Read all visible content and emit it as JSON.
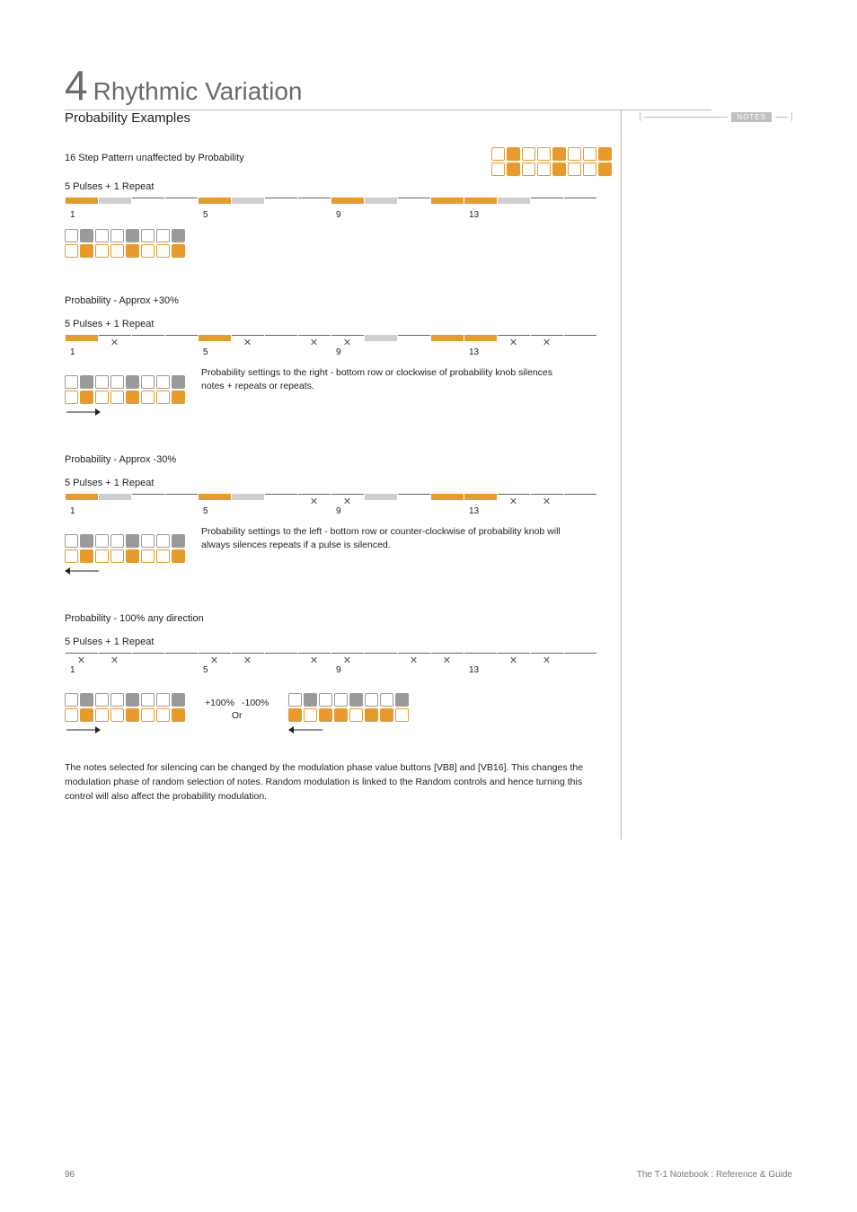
{
  "chapter": {
    "number": "4",
    "title": "Rhythmic Variation"
  },
  "notes_label": "NOTES",
  "subtitle": "Probability Examples",
  "ex1": {
    "caption_top": "16 Step Pattern unaffected by Probability",
    "caption_sub": "5 Pulses + 1 Repeat",
    "grid_top": [
      "",
      "f",
      "",
      "",
      "f",
      "",
      "",
      "f"
    ],
    "grid_bot": [
      "",
      "f",
      "",
      "",
      "f",
      "",
      "",
      "f"
    ],
    "nums": {
      "n1": "1",
      "n5": "5",
      "n9": "9",
      "n13": "13"
    }
  },
  "ex2": {
    "caption_top": "Probability - Approx +30%",
    "caption_sub": "5 Pulses + 1 Repeat",
    "grid_top": [
      "",
      "f",
      "",
      "",
      "f",
      "",
      "",
      "f"
    ],
    "grid_bot": [
      "",
      "f",
      "",
      "",
      "f",
      "",
      "",
      "f"
    ],
    "side": "Probability settings to the right - bottom row or clockwise of probability knob silences notes + repeats or repeats.",
    "nums": {
      "n1": "1",
      "n5": "5",
      "n9": "9",
      "n13": "13"
    }
  },
  "ex3": {
    "caption_top": "Probability - Approx -30%",
    "caption_sub": "5 Pulses + 1 Repeat",
    "grid_top": [
      "",
      "f",
      "",
      "",
      "f",
      "",
      "",
      "f"
    ],
    "grid_bot": [
      "",
      "f",
      "",
      "",
      "f",
      "",
      "",
      "f"
    ],
    "side": "Probability settings to the left - bottom row or counter-clockwise of probability knob will always silences repeats if a pulse is silenced.",
    "nums": {
      "n1": "1",
      "n5": "5",
      "n9": "9",
      "n13": "13"
    }
  },
  "ex4": {
    "caption_top": "Probability - 100% any direction",
    "caption_sub": "5 Pulses + 1 Repeat",
    "left_label": "+100%",
    "right_label": "-100%",
    "mid_label": "Or",
    "nums": {
      "n1": "1",
      "n5": "5",
      "n9": "9",
      "n13": "13"
    }
  },
  "body_text": "The notes selected for silencing can be changed by the modulation phase value buttons [VB8] and [VB16]. This changes the modulation phase of random selection of notes. Random modulation is linked to the Random controls and hence turning this control will also affect the probability modulation.",
  "footer": {
    "page": "96",
    "book": "The T-1 Notebook : Reference & Guide"
  },
  "chart_data": [
    {
      "type": "table",
      "title": "16 Step Pattern unaffected by Probability — 5 Pulses + 1 Repeat",
      "columns": [
        "step",
        "state"
      ],
      "rows": [
        [
          1,
          "pulse"
        ],
        [
          2,
          "repeat"
        ],
        [
          3,
          "off"
        ],
        [
          4,
          "off"
        ],
        [
          5,
          "pulse"
        ],
        [
          6,
          "repeat"
        ],
        [
          7,
          "off"
        ],
        [
          8,
          "off"
        ],
        [
          9,
          "pulse"
        ],
        [
          10,
          "repeat"
        ],
        [
          11,
          "off"
        ],
        [
          12,
          "pulse"
        ],
        [
          13,
          "pulse"
        ],
        [
          14,
          "repeat"
        ],
        [
          15,
          "off"
        ],
        [
          16,
          "off"
        ]
      ]
    },
    {
      "type": "table",
      "title": "Probability Approx +30% — silenced steps",
      "columns": [
        "step",
        "state"
      ],
      "rows": [
        [
          1,
          "pulse"
        ],
        [
          2,
          "silenced"
        ],
        [
          3,
          "off"
        ],
        [
          4,
          "off"
        ],
        [
          5,
          "pulse"
        ],
        [
          6,
          "silenced"
        ],
        [
          7,
          "off"
        ],
        [
          8,
          "silenced"
        ],
        [
          9,
          "silenced"
        ],
        [
          10,
          "repeat"
        ],
        [
          11,
          "off"
        ],
        [
          12,
          "pulse"
        ],
        [
          13,
          "pulse"
        ],
        [
          14,
          "silenced"
        ],
        [
          15,
          "silenced"
        ],
        [
          16,
          "off"
        ]
      ]
    },
    {
      "type": "table",
      "title": "Probability Approx -30% — silenced steps",
      "columns": [
        "step",
        "state"
      ],
      "rows": [
        [
          1,
          "pulse"
        ],
        [
          2,
          "repeat"
        ],
        [
          3,
          "off"
        ],
        [
          4,
          "off"
        ],
        [
          5,
          "pulse"
        ],
        [
          6,
          "repeat"
        ],
        [
          7,
          "off"
        ],
        [
          8,
          "silenced"
        ],
        [
          9,
          "silenced"
        ],
        [
          10,
          "repeat"
        ],
        [
          11,
          "off"
        ],
        [
          12,
          "pulse"
        ],
        [
          13,
          "pulse"
        ],
        [
          14,
          "silenced"
        ],
        [
          15,
          "silenced"
        ],
        [
          16,
          "off"
        ]
      ]
    },
    {
      "type": "table",
      "title": "Probability 100% any direction — silenced steps",
      "columns": [
        "step",
        "state"
      ],
      "rows": [
        [
          1,
          "silenced"
        ],
        [
          2,
          "silenced"
        ],
        [
          3,
          "off"
        ],
        [
          4,
          "off"
        ],
        [
          5,
          "silenced"
        ],
        [
          6,
          "silenced"
        ],
        [
          7,
          "off"
        ],
        [
          8,
          "silenced"
        ],
        [
          9,
          "silenced"
        ],
        [
          10,
          "off"
        ],
        [
          11,
          "silenced"
        ],
        [
          12,
          "silenced"
        ],
        [
          13,
          "off"
        ],
        [
          14,
          "silenced"
        ],
        [
          15,
          "silenced"
        ],
        [
          16,
          "off"
        ]
      ]
    }
  ]
}
